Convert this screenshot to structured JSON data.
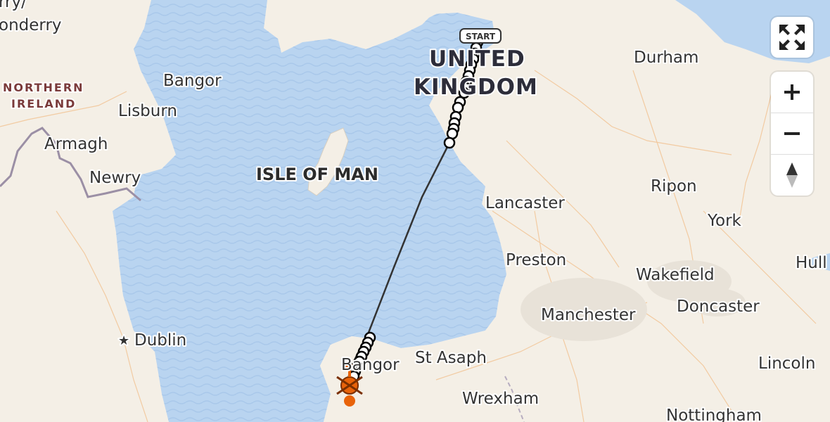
{
  "map": {
    "labels": {
      "londonderry": "rry/\nonderry",
      "northern_ireland": "NORTHERN\nIRELAND",
      "bangor_ni": "Bangor",
      "lisburn": "Lisburn",
      "armagh": "Armagh",
      "newry": "Newry",
      "isle_of_man": "ISLE OF MAN",
      "united_kingdom_1": "UNITED",
      "united_kingdom_2": "KINGDOM",
      "durham": "Durham",
      "ripon": "Ripon",
      "lancaster": "Lancaster",
      "york": "York",
      "preston": "Preston",
      "wakefield": "Wakefield",
      "hull": "Hull",
      "manchester": "Manchester",
      "doncaster": "Doncaster",
      "dublin": "Dublin",
      "bangor_wales": "Bangor",
      "st_asaph": "St Asaph",
      "lincoln": "Lincoln",
      "wrexham": "Wrexham",
      "nottingham": "Nottingham"
    },
    "start_marker": "START",
    "route_color": "#333333",
    "water_color": "#b9d4f0",
    "land_color": "#f4efe6",
    "heli_color": "#e8630a"
  },
  "controls": {
    "fullscreen_icon": "fullscreen-icon",
    "zoom_in_icon": "plus-icon",
    "zoom_out_icon": "minus-icon",
    "compass_icon": "compass-icon"
  }
}
